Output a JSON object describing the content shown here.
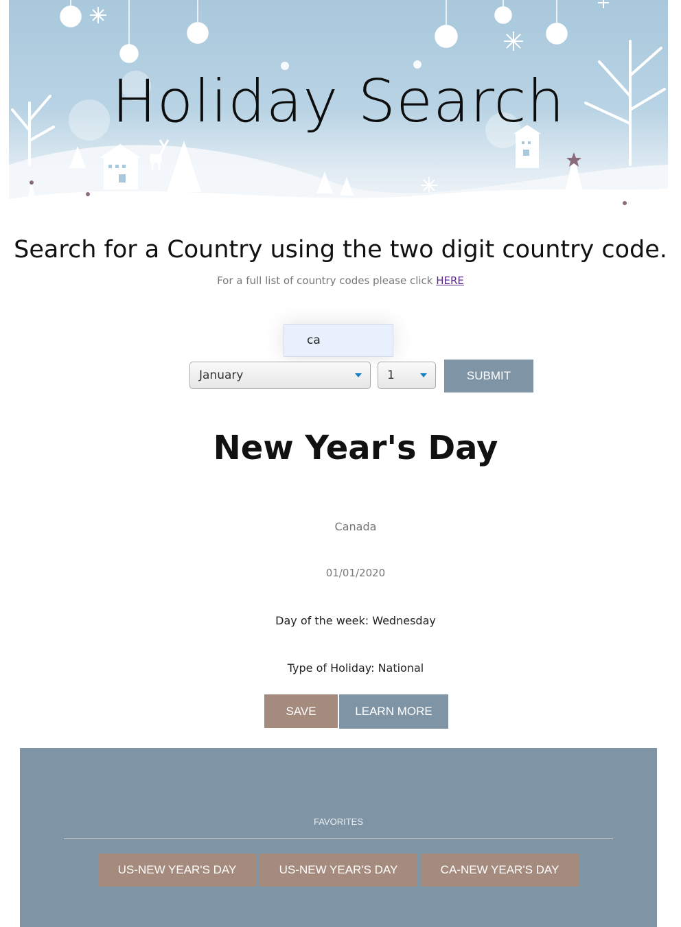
{
  "banner": {
    "title": "Holiday Search"
  },
  "intro": {
    "headline": "Search for a Country using the two digit country code.",
    "subline_text": "For a full list of country codes please click ",
    "subline_link": "HERE"
  },
  "search": {
    "country_code_value": "ca",
    "month_selected": "January",
    "day_selected": "1",
    "submit_label": "SUBMIT"
  },
  "result": {
    "holiday_name": "New Year's Day",
    "country": "Canada",
    "date": "01/01/2020",
    "weekday": "Day of the week: Wednesday",
    "type": "Type of Holiday: National",
    "save_label": "SAVE",
    "learn_more_label": "LEARN MORE"
  },
  "favorites": {
    "title": "FAVORITES",
    "items": [
      "US-NEW YEAR'S DAY",
      "US-NEW YEAR'S DAY",
      "CA-NEW YEAR'S DAY"
    ]
  },
  "colors": {
    "slate_button": "#7f95a6",
    "taupe_button": "#a58b7e",
    "link": "#5b2a86"
  }
}
